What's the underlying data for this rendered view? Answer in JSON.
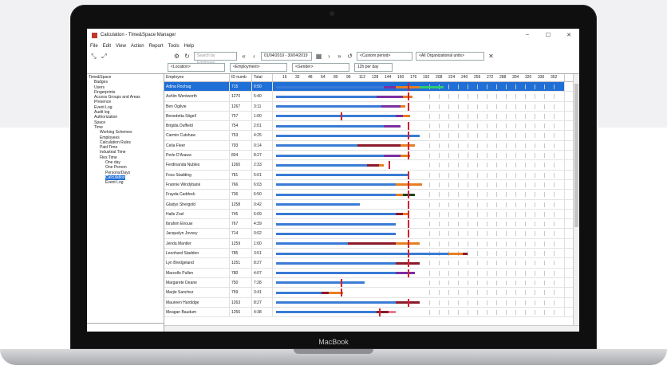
{
  "window": {
    "title": "Calculation - Time&Space Manager",
    "controls": [
      "–",
      "☐",
      "✕"
    ]
  },
  "menu": [
    "File",
    "Edit",
    "View",
    "Action",
    "Report",
    "Tools",
    "Help"
  ],
  "toolbar": {
    "search_placeholder": "Search by Employee",
    "date_range": "01/04/2019 - 30/04/2019",
    "period": "<Custom period>",
    "org_units": "<All Organizational units>"
  },
  "filters": {
    "location": "<Location>",
    "employment": "<Employment>",
    "gender": "<Gender>",
    "per_day": "12h per day"
  },
  "tree": [
    {
      "label": "Time&Space",
      "indent": 0
    },
    {
      "label": "Badges",
      "indent": 1
    },
    {
      "label": "Users",
      "indent": 1
    },
    {
      "label": "Fingerprints",
      "indent": 1
    },
    {
      "label": "Access Groups and Areas",
      "indent": 1
    },
    {
      "label": "Presence",
      "indent": 1
    },
    {
      "label": "Event Log",
      "indent": 1
    },
    {
      "label": "Audit log",
      "indent": 1
    },
    {
      "label": "Authorization",
      "indent": 1
    },
    {
      "label": "Space",
      "indent": 1
    },
    {
      "label": "Time",
      "indent": 1
    },
    {
      "label": "Working Schemes",
      "indent": 2
    },
    {
      "label": "Employees",
      "indent": 2
    },
    {
      "label": "Calculation Rules",
      "indent": 2
    },
    {
      "label": "Paid Time",
      "indent": 2
    },
    {
      "label": "Industrial Time",
      "indent": 2
    },
    {
      "label": "Flex Time",
      "indent": 2
    },
    {
      "label": "One day",
      "indent": 3
    },
    {
      "label": "One Person",
      "indent": 3
    },
    {
      "label": "Persons/Days",
      "indent": 3
    },
    {
      "label": "Calculation",
      "indent": 3,
      "selected": true
    },
    {
      "label": "Event Log",
      "indent": 3
    }
  ],
  "columns": {
    "employee": "Employee",
    "id": "ID numb",
    "total": "Total"
  },
  "axis_ticks": [
    "16",
    "32",
    "48",
    "64",
    "80",
    "96",
    "112",
    "128",
    "144",
    "160",
    "176",
    "192",
    "208",
    "224",
    "240",
    "256",
    "272",
    "288",
    "304",
    "320",
    "336",
    "352"
  ],
  "rows": [
    {
      "name": "Adina Rochug",
      "id": "715",
      "total": "0:50",
      "bars": [
        [
          "#3a7bd5",
          0,
          0.45
        ],
        [
          "#7b2fa1",
          0.45,
          0.5
        ],
        [
          "#e67e22",
          0.5,
          0.6
        ],
        [
          "#2ecc71",
          0.6,
          0.7
        ]
      ],
      "red": 0.55
    },
    {
      "name": "Ashlin Wentworth",
      "id": "1270",
      "total": "5:40",
      "bars": [
        [
          "#3a7bd5",
          0,
          0.42
        ],
        [
          "#7b2fa1",
          0.42,
          0.53
        ],
        [
          "#e67e22",
          0.53,
          0.57
        ]
      ],
      "red": 0.55
    },
    {
      "name": "Ben Ogilvie",
      "id": "1267",
      "total": "3:11",
      "bars": [
        [
          "#3a7bd5",
          0,
          0.44
        ],
        [
          "#7b2fa1",
          0.44,
          0.52
        ],
        [
          "#e67e22",
          0.52,
          0.54
        ]
      ],
      "red": 0.55
    },
    {
      "name": "Benedetta Stigell",
      "id": "757",
      "total": "1:00",
      "bars": [
        [
          "#3a7bd5",
          0,
          0.5
        ],
        [
          "#7b2fa1",
          0.5,
          0.53
        ],
        [
          "#e67e22",
          0.53,
          0.56
        ]
      ],
      "red": 0.27
    },
    {
      "name": "Brigida Duffield",
      "id": "754",
      "total": "2:01",
      "bars": [
        [
          "#3a7bd5",
          0,
          0.45
        ],
        [
          "#7b2fa1",
          0.45,
          0.52
        ]
      ],
      "red": 0.55
    },
    {
      "name": "Carmin Cutshaw",
      "id": "753",
      "total": "4:25",
      "bars": [
        [
          "#3a7bd5",
          0,
          0.6
        ]
      ],
      "red": 0.55
    },
    {
      "name": "Celia Fleer",
      "id": "793",
      "total": "0:14",
      "bars": [
        [
          "#3a7bd5",
          0,
          0.34
        ],
        [
          "#8b1a2b",
          0.34,
          0.52
        ],
        [
          "#e67e22",
          0.52,
          0.58
        ]
      ],
      "red": 0.55
    },
    {
      "name": "Perle D'Arauw",
      "id": "804",
      "total": "8:27",
      "bars": [
        [
          "#3a7bd5",
          0,
          0.45
        ],
        [
          "#7b2fa1",
          0.45,
          0.52
        ],
        [
          "#e67e22",
          0.52,
          0.56
        ]
      ],
      "red": 0.55
    },
    {
      "name": "Ferdinanda Nubles",
      "id": "1260",
      "total": "2:33",
      "bars": [
        [
          "#3a7bd5",
          0,
          0.38
        ],
        [
          "#8b1a2b",
          0.38,
          0.43
        ],
        [
          "#e67e22",
          0.43,
          0.45
        ]
      ],
      "red": 0.47
    },
    {
      "name": "Foss Stadding",
      "id": "781",
      "total": "5:01",
      "bars": [
        [
          "#3a7bd5",
          0,
          0.55
        ]
      ],
      "red": 0.55
    },
    {
      "name": "Frannie Windybank",
      "id": "766",
      "total": "6:03",
      "bars": [
        [
          "#3a7bd5",
          0,
          0.5
        ],
        [
          "#e67e22",
          0.5,
          0.61
        ]
      ],
      "red": 0.55
    },
    {
      "name": "Frayda Caddock",
      "id": "736",
      "total": "6:50",
      "bars": [
        [
          "#3a7bd5",
          0,
          0.5
        ],
        [
          "#e67e22",
          0.5,
          0.53
        ],
        [
          "#1e4620",
          0.53,
          0.58
        ]
      ],
      "red": 0.55
    },
    {
      "name": "Gladys Shergold",
      "id": "1258",
      "total": "0:42",
      "bars": [
        [
          "#3a7bd5",
          0,
          0.35
        ]
      ],
      "red": 0.55
    },
    {
      "name": "Halle Zoel",
      "id": "745",
      "total": "6:09",
      "bars": [
        [
          "#3a7bd5",
          0,
          0.5
        ],
        [
          "#8b1a2b",
          0.5,
          0.53
        ],
        [
          "#e67e22",
          0.53,
          0.55
        ]
      ],
      "red": 0.55
    },
    {
      "name": "Ibrahim Elrouw",
      "id": "767",
      "total": "4:39",
      "bars": [
        [
          "#3a7bd5",
          0,
          0.5
        ]
      ],
      "red": 0.55
    },
    {
      "name": "Jacquelyn Jovsey",
      "id": "714",
      "total": "0:02",
      "bars": [
        [
          "#3a7bd5",
          0,
          0.5
        ]
      ],
      "red": 0.55
    },
    {
      "name": "Jenda Mantler",
      "id": "1259",
      "total": "1:00",
      "bars": [
        [
          "#3a7bd5",
          0,
          0.3
        ],
        [
          "#8b1a2b",
          0.3,
          0.5
        ],
        [
          "#e67e22",
          0.5,
          0.6
        ]
      ],
      "red": 0.55
    },
    {
      "name": "Leonhard Stadden",
      "id": "785",
      "total": "3:51",
      "bars": [
        [
          "#3a7bd5",
          0,
          0.72
        ],
        [
          "#e67e22",
          0.72,
          0.78
        ],
        [
          "#8b1a2b",
          0.78,
          0.8
        ]
      ],
      "red": 0.55
    },
    {
      "name": "Lyn Bredgeland",
      "id": "1251",
      "total": "8:27",
      "bars": [
        [
          "#3a7bd5",
          0,
          0.5
        ],
        [
          "#8b1a2b",
          0.5,
          0.6
        ]
      ],
      "red": 0.55
    },
    {
      "name": "Marcelle Pullen",
      "id": "780",
      "total": "4:07",
      "bars": [
        [
          "#3a7bd5",
          0,
          0.5
        ],
        [
          "#7b2fa1",
          0.5,
          0.58
        ]
      ],
      "red": 0.55
    },
    {
      "name": "Margarete Deane",
      "id": "750",
      "total": "7:28",
      "bars": [
        [
          "#3a7bd5",
          0,
          0.37
        ]
      ],
      "red": 0.27
    },
    {
      "name": "Marjie Sanchez",
      "id": "759",
      "total": "3:41",
      "bars": [
        [
          "#3a7bd5",
          0,
          0.19
        ],
        [
          "#8b1a2b",
          0.19,
          0.22
        ],
        [
          "#e67e22",
          0.22,
          0.28
        ]
      ],
      "red": 0.27
    },
    {
      "name": "Maureen Hurdidge",
      "id": "1263",
      "total": "8:27",
      "bars": [
        [
          "#3a7bd5",
          0,
          0.5
        ],
        [
          "#8b1a2b",
          0.5,
          0.6
        ]
      ],
      "red": 0.55
    },
    {
      "name": "Meagan Baudum",
      "id": "1256",
      "total": "4:38",
      "bars": [
        [
          "#3a7bd5",
          0,
          0.42
        ],
        [
          "#8b1a2b",
          0.42,
          0.47
        ],
        [
          "#e87b8c",
          0.47,
          0.5
        ]
      ],
      "red": 0.43
    }
  ],
  "laptop_brand": "MacBook"
}
